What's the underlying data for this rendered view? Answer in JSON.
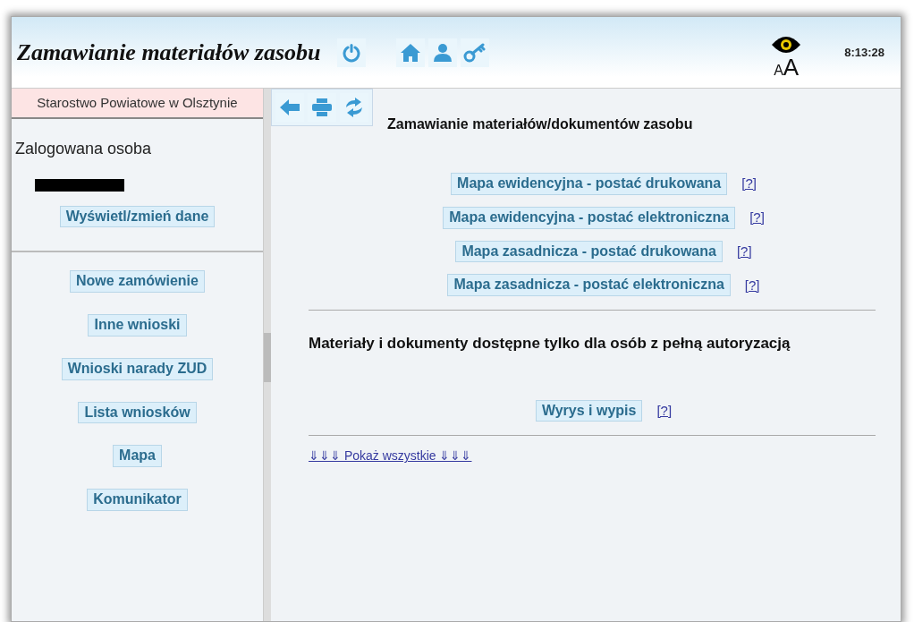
{
  "header": {
    "title": "Zamawianie materiałów zasobu",
    "font_size_toggle": "AA",
    "clock": "8:13:28"
  },
  "sidebar": {
    "office": "Starostwo Powiatowe w Olsztynie",
    "logged_in_label": "Zalogowana osoba",
    "profile_button": "Wyświetl/zmień dane",
    "menu": [
      {
        "label": "Nowe zamówienie"
      },
      {
        "label": "Inne wnioski"
      },
      {
        "label": "Wnioski narady ZUD"
      },
      {
        "label": "Lista wniosków"
      },
      {
        "label": "Mapa"
      },
      {
        "label": "Komunikator"
      }
    ]
  },
  "main": {
    "title": "Zamawianie materiałów/dokumentów zasobu",
    "options": [
      {
        "label": "Mapa ewidencyjna - postać drukowana",
        "help": "[?]"
      },
      {
        "label": "Mapa ewidencyjna - postać elektroniczna",
        "help": "[?]"
      },
      {
        "label": "Mapa zasadnicza - postać drukowana",
        "help": "[?]"
      },
      {
        "label": "Mapa zasadnicza - postać elektroniczna",
        "help": "[?]"
      }
    ],
    "restricted_title": "Materiały i dokumenty dostępne tylko dla osób z pełną autoryzacją",
    "restricted_options": [
      {
        "label": "Wyrys i wypis",
        "help": "[?]"
      }
    ],
    "show_all": "⇓⇓⇓ Pokaż wszystkie ⇓⇓⇓"
  }
}
